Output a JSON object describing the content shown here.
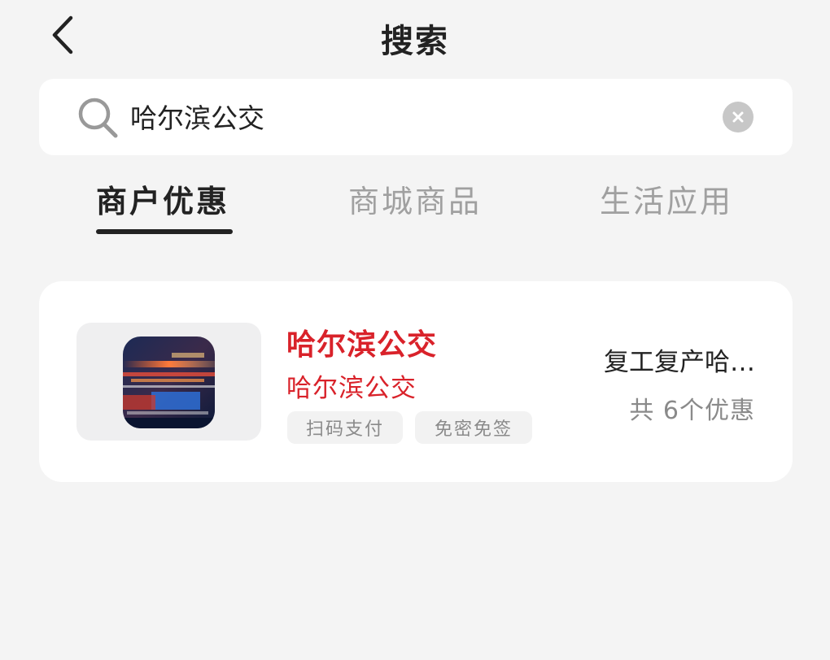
{
  "header": {
    "title": "搜索"
  },
  "search": {
    "value": "哈尔滨公交"
  },
  "tabs": [
    {
      "label": "商户优惠",
      "active": true
    },
    {
      "label": "商城商品",
      "active": false
    },
    {
      "label": "生活应用",
      "active": false
    }
  ],
  "result": {
    "icon": "bus-photo-icon",
    "name": "哈尔滨公交",
    "subtitle": "哈尔滨公交",
    "tags": [
      "扫码支付",
      "免密免签"
    ],
    "promo_title": "复工复产哈…",
    "promo_count": "共 6个优惠"
  },
  "colors": {
    "background": "#f4f4f4",
    "accent_red": "#d9222a",
    "muted_text": "#a0a0a0"
  }
}
